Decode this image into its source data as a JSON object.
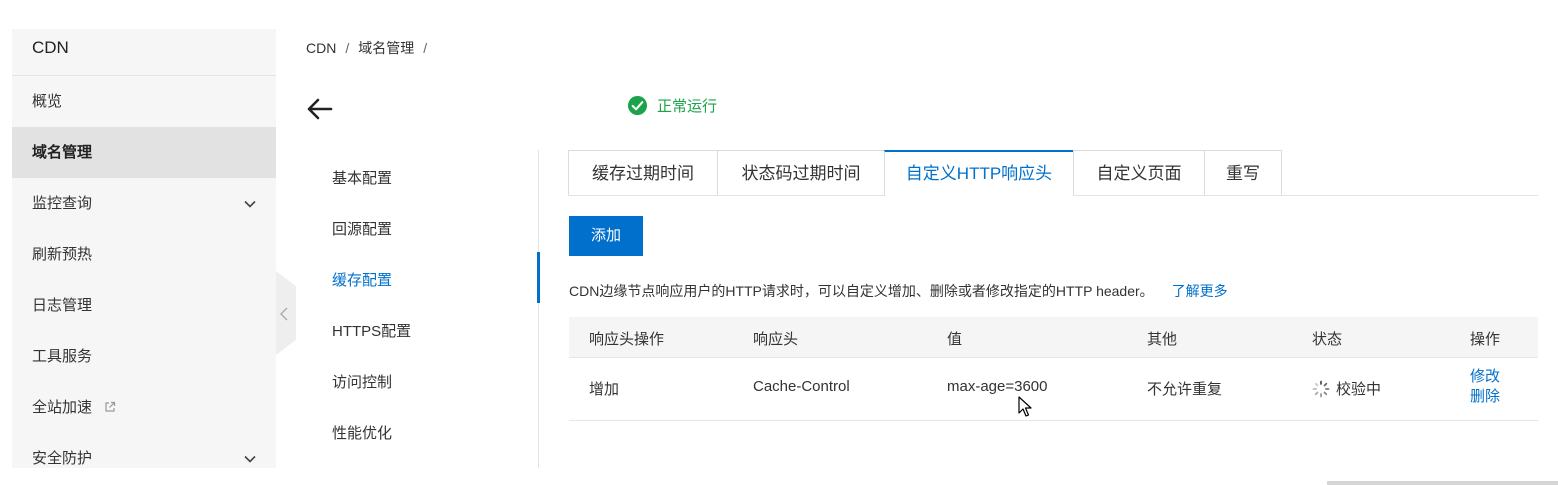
{
  "sidebar": {
    "title": "CDN",
    "items": [
      {
        "label": "概览"
      },
      {
        "label": "域名管理"
      },
      {
        "label": "监控查询"
      },
      {
        "label": "刷新预热"
      },
      {
        "label": "日志管理"
      },
      {
        "label": "工具服务"
      },
      {
        "label": "全站加速"
      },
      {
        "label": "安全防护"
      }
    ]
  },
  "breadcrumb": {
    "root": "CDN",
    "sep1": "/",
    "current": "域名管理",
    "sep2": "/"
  },
  "header": {
    "status": "正常运行"
  },
  "subnav": {
    "items": [
      {
        "label": "基本配置"
      },
      {
        "label": "回源配置"
      },
      {
        "label": "缓存配置"
      },
      {
        "label": "HTTPS配置"
      },
      {
        "label": "访问控制"
      },
      {
        "label": "性能优化"
      }
    ]
  },
  "tabs": [
    {
      "label": "缓存过期时间"
    },
    {
      "label": "状态码过期时间"
    },
    {
      "label": "自定义HTTP响应头"
    },
    {
      "label": "自定义页面"
    },
    {
      "label": "重写"
    }
  ],
  "actions": {
    "add_label": "添加"
  },
  "description": {
    "text": "CDN边缘节点响应用户的HTTP请求时，可以自定义增加、删除或者修改指定的HTTP header。",
    "link": "了解更多"
  },
  "table": {
    "headers": {
      "op": "响应头操作",
      "header": "响应头",
      "value": "值",
      "other": "其他",
      "status": "状态",
      "actions": "操作"
    },
    "rows": [
      {
        "op": "增加",
        "header": "Cache-Control",
        "value": "max-age=3600",
        "other": "不允许重复",
        "status": "校验中",
        "edit": "修改",
        "delete": "删除"
      }
    ]
  },
  "colors": {
    "accent": "#0070cc",
    "success": "#1aa34a",
    "sidebar_bg": "#f6f6f6",
    "sidebar_active": "#e2e2e2"
  }
}
